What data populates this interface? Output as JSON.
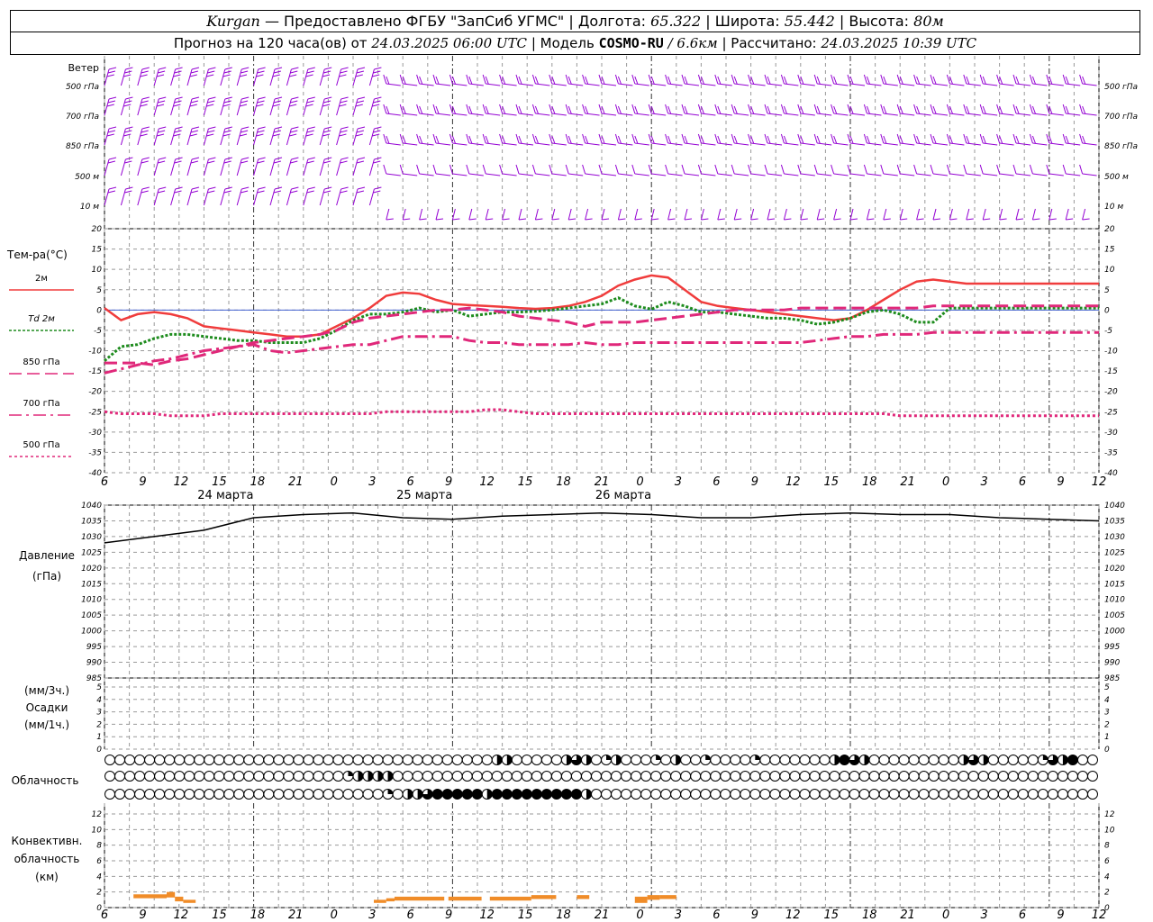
{
  "header": {
    "station": "Kurgan",
    "provider": "— Предоставлено ФГБУ \"ЗапСиб УГМС\" |",
    "lon_label": "Долгота:",
    "lon": "65.322",
    "lat_label": "| Широта:",
    "lat": "55.442",
    "alt_label": "| Высота:",
    "alt": "80м",
    "forecast_label": "Прогноз на 120 часа(ов) от",
    "forecast_start": "24.03.2025 06:00 UTC",
    "model_label": "| Модель",
    "model": "COSMO-RU",
    "model_res": "/ 6.6км",
    "calc_label": "| Рассчитано:",
    "calc_time": "24.03.2025 10:39 UTC"
  },
  "chart_data": [
    {
      "type": "line",
      "panel": "wind",
      "title": "Ветер",
      "levels": [
        "500 гПа",
        "700 гПа",
        "850 гПа",
        "500 м",
        "10 м"
      ],
      "colors": {
        "barbs": "#9400d3"
      }
    },
    {
      "type": "line",
      "panel": "temperature",
      "title": "Тем-ра(°С)",
      "ylim": [
        -40,
        20
      ],
      "yticks": [
        20,
        15,
        10,
        5,
        0,
        -5,
        -10,
        -15,
        -20,
        -25,
        -30,
        -35,
        -40
      ],
      "x_hours_from_start": [
        0,
        2,
        4,
        6,
        8,
        10,
        12,
        14,
        16,
        18,
        20,
        22,
        24,
        26,
        28,
        30,
        32,
        34,
        36,
        38,
        40,
        42,
        44,
        46,
        48,
        50,
        52,
        54,
        56,
        58,
        60,
        62,
        64,
        66,
        68,
        70,
        72,
        74,
        76,
        78,
        80,
        82,
        84,
        86,
        88,
        90,
        92,
        94,
        96,
        98,
        100,
        102,
        104,
        106,
        108,
        110,
        112,
        114,
        116,
        118,
        120
      ],
      "series": [
        {
          "name": "2м",
          "color": "#f03c3c",
          "style": "solid",
          "values": [
            0.5,
            -2.5,
            -1,
            -0.5,
            -1,
            -2,
            -4,
            -4.5,
            -5,
            -5.5,
            -6,
            -6.5,
            -6.5,
            -6,
            -4,
            -2,
            0.5,
            3.5,
            4.3,
            4,
            2.5,
            1.5,
            1.2,
            1,
            0.8,
            0.5,
            0.3,
            0.5,
            1,
            2,
            3.5,
            6,
            7.5,
            8.5,
            8,
            5,
            2,
            1,
            0.5,
            0,
            -0.5,
            -1,
            -1.5,
            -2,
            -2.5,
            -2,
            0,
            2.5,
            5,
            7,
            7.5,
            7,
            6.5,
            6.5,
            6.5,
            6.5,
            6.5,
            6.5,
            6.5,
            6.5,
            6.5
          ]
        },
        {
          "name": "Td 2м",
          "color": "#1e8c1e",
          "style": "dotted",
          "values": [
            -12.5,
            -9,
            -8.5,
            -7,
            -6,
            -6,
            -6.5,
            -7,
            -7.5,
            -7.5,
            -8,
            -8,
            -8,
            -7,
            -5,
            -2.5,
            -1,
            -1,
            -0.5,
            0.5,
            -0.5,
            0,
            -1.5,
            -1,
            -0.5,
            -0.5,
            -0.3,
            0,
            0.5,
            1,
            1.5,
            3,
            1,
            0.2,
            2,
            1,
            -0.5,
            -0.5,
            -1,
            -1.5,
            -2,
            -2,
            -2.5,
            -3.5,
            -3,
            -2,
            -0.5,
            0,
            -1,
            -3,
            -3,
            0.5,
            0.5,
            0.5,
            0.5,
            0.5,
            0.5,
            0.5,
            0.5,
            0.5,
            0.5
          ]
        },
        {
          "name": "850 гПа",
          "color": "#e0287a",
          "style": "dashed",
          "values": [
            -13,
            -13,
            -13,
            -13.5,
            -12.5,
            -12,
            -11,
            -10,
            -9,
            -8,
            -7.5,
            -7,
            -6.5,
            -6,
            -5,
            -3,
            -2,
            -1.5,
            -1,
            -0.5,
            0,
            0,
            0.5,
            0,
            -0.5,
            -1.5,
            -2,
            -2.5,
            -3,
            -4,
            -3,
            -3,
            -3,
            -2.5,
            -2,
            -1.5,
            -1,
            -0.5,
            0,
            0,
            0,
            0,
            0.5,
            0.5,
            0.5,
            0.5,
            0.5,
            0.5,
            0.5,
            0.5,
            1,
            1,
            1,
            1,
            1,
            1,
            1,
            1,
            1,
            1,
            1
          ]
        },
        {
          "name": "700 гПа",
          "color": "#e0287a",
          "style": "dashdot",
          "values": [
            -15.5,
            -14.5,
            -13.5,
            -12.5,
            -12,
            -11,
            -10,
            -9.5,
            -9,
            -8.5,
            -10,
            -10.5,
            -10,
            -9.5,
            -9,
            -8.5,
            -8.5,
            -7.5,
            -6.5,
            -6.5,
            -6.5,
            -6.5,
            -7.5,
            -8,
            -8,
            -8.5,
            -8.5,
            -8.5,
            -8.5,
            -8,
            -8.5,
            -8.5,
            -8,
            -8,
            -8,
            -8,
            -8,
            -8,
            -8,
            -8,
            -8,
            -8,
            -8,
            -7.5,
            -7,
            -6.5,
            -6.5,
            -6,
            -6,
            -6,
            -5.5,
            -5.5,
            -5.5,
            -5.5,
            -5.5,
            -5.5,
            -5.5,
            -5.5,
            -5.5,
            -5.5,
            -5.5
          ]
        },
        {
          "name": "500 гПа",
          "color": "#e0287a",
          "style": "finedash",
          "values": [
            -25,
            -25.5,
            -25.5,
            -25.5,
            -26,
            -26,
            -26,
            -25.5,
            -25.5,
            -25.5,
            -25.5,
            -25.5,
            -25.5,
            -25.5,
            -25.5,
            -25.5,
            -25.5,
            -25,
            -25,
            -25,
            -25,
            -25,
            -25,
            -24.5,
            -24.5,
            -25,
            -25.5,
            -25.5,
            -25.5,
            -25.5,
            -25.5,
            -25.5,
            -25.5,
            -25.5,
            -25.5,
            -25.5,
            -25.5,
            -25.5,
            -25.5,
            -25.5,
            -25.5,
            -25.5,
            -25.5,
            -25.5,
            -25.5,
            -25.5,
            -25.5,
            -25.5,
            -26,
            -26,
            -26,
            -26,
            -26,
            -26,
            -26,
            -26,
            -26,
            -26,
            -26,
            -26,
            -26
          ]
        }
      ]
    },
    {
      "type": "line",
      "panel": "pressure",
      "title": "Давление",
      "ylabel": "(гПа)",
      "ylim": [
        985,
        1040
      ],
      "yticks": [
        1040,
        1035,
        1030,
        1025,
        1020,
        1015,
        1010,
        1005,
        1000,
        995,
        990,
        985
      ],
      "x_hours_from_start": [
        0,
        6,
        12,
        18,
        24,
        30,
        36,
        42,
        48,
        54,
        60,
        66,
        72,
        78,
        84,
        90,
        96,
        102,
        108,
        114,
        120
      ],
      "series": [
        {
          "name": "Давление",
          "color": "#000000",
          "values": [
            1028,
            1030,
            1032,
            1036,
            1037,
            1037.5,
            1036,
            1035.5,
            1036.5,
            1037,
            1037.5,
            1037,
            1036,
            1036,
            1037,
            1037.5,
            1037,
            1037,
            1036,
            1035.5,
            1035
          ]
        }
      ]
    },
    {
      "type": "bar",
      "panel": "precipitation",
      "title": "Осадки",
      "ylabel_top": "(мм/3ч.)",
      "ylabel_bottom": "(мм/1ч.)",
      "ylim": [
        0,
        6
      ],
      "yticks": [
        6,
        5,
        4,
        3,
        2,
        1,
        0
      ],
      "values": []
    },
    {
      "type": "table",
      "panel": "cloudiness",
      "title": "Облачность",
      "slots": 60,
      "rows": [
        {
          "name": "upper",
          "values": [
            0,
            0,
            0,
            0,
            0,
            0,
            0,
            0,
            0,
            0,
            0,
            0,
            0,
            0,
            0,
            0,
            0,
            0,
            0,
            0,
            0,
            0,
            0,
            0,
            0,
            0,
            0,
            0,
            0,
            0,
            0,
            0,
            0,
            0,
            0,
            0,
            0,
            0,
            0,
            0,
            0,
            0,
            0,
            0,
            0,
            0,
            0,
            0,
            0,
            0,
            0,
            0,
            0,
            0,
            0,
            0,
            0,
            0,
            0,
            0
          ]
        },
        {
          "name": "middle",
          "values": [
            0,
            0,
            0,
            0,
            0,
            0,
            0,
            0,
            0,
            0,
            0,
            0,
            0,
            0,
            0,
            0,
            0,
            0,
            0,
            0,
            0,
            0,
            0,
            0,
            0,
            0,
            0,
            0,
            0,
            0,
            0,
            0,
            0,
            0,
            0,
            0,
            0,
            0,
            0,
            0,
            0,
            0,
            0,
            0,
            0,
            0,
            0,
            0,
            0,
            0,
            0,
            0,
            0,
            0,
            0,
            0,
            0,
            0,
            0,
            0
          ]
        },
        {
          "name": "lower",
          "values": [
            0,
            0,
            0,
            0,
            0,
            0,
            0,
            0,
            0,
            0,
            0,
            0,
            0,
            0,
            0,
            0,
            0,
            0,
            0,
            0,
            0,
            0,
            0,
            0,
            0,
            0,
            0,
            0,
            0,
            0,
            0,
            0,
            0,
            0,
            0,
            0,
            0,
            0,
            0,
            0,
            0,
            0,
            0,
            0,
            0,
            0,
            0,
            0,
            0,
            0,
            0,
            0,
            0,
            0,
            0,
            0,
            0,
            0,
            0,
            0
          ]
        }
      ],
      "cells": [
        {
          "r": 0,
          "i": 46,
          "f": 0.5
        },
        {
          "r": 0,
          "i": 47,
          "f": 0.75
        },
        {
          "r": 0,
          "i": 48,
          "f": 0.5
        },
        {
          "r": 0,
          "i": 50,
          "f": 0.25
        },
        {
          "r": 0,
          "i": 51,
          "f": 0.5
        },
        {
          "r": 0,
          "i": 55,
          "f": 0.25
        },
        {
          "r": 0,
          "i": 57,
          "f": 0.5
        },
        {
          "r": 0,
          "i": 60,
          "f": 0.25
        },
        {
          "r": 0,
          "i": 65,
          "f": 0.25
        },
        {
          "r": 0,
          "i": 73,
          "f": 0.5
        },
        {
          "r": 0,
          "i": 74,
          "f": 1
        },
        {
          "r": 0,
          "i": 75,
          "f": 0.75
        },
        {
          "r": 0,
          "i": 76,
          "f": 0.5
        },
        {
          "r": 0,
          "i": 86,
          "f": 0.5
        },
        {
          "r": 0,
          "i": 87,
          "f": 0.75
        },
        {
          "r": 0,
          "i": 88,
          "f": 0.5
        },
        {
          "r": 0,
          "i": 94,
          "f": 0.25
        },
        {
          "r": 0,
          "i": 95,
          "f": 0.75
        },
        {
          "r": 0,
          "i": 96,
          "f": 0.5
        },
        {
          "r": 0,
          "i": 97,
          "f": 1
        },
        {
          "r": 0,
          "i": 39,
          "f": 0.5
        },
        {
          "r": 0,
          "i": 40,
          "f": 0.5
        },
        {
          "r": 1,
          "i": 24,
          "f": 0.25
        },
        {
          "r": 1,
          "i": 25,
          "f": 0.5
        },
        {
          "r": 1,
          "i": 26,
          "f": 0.5
        },
        {
          "r": 1,
          "i": 27,
          "f": 0.5
        },
        {
          "r": 1,
          "i": 28,
          "f": 0.5
        },
        {
          "r": 2,
          "i": 28,
          "f": 0.25
        },
        {
          "r": 2,
          "i": 30,
          "f": 0.5
        },
        {
          "r": 2,
          "i": 31,
          "f": 0.5
        },
        {
          "r": 2,
          "i": 32,
          "f": 0.75
        },
        {
          "r": 2,
          "i": 33,
          "f": 1
        },
        {
          "r": 2,
          "i": 34,
          "f": 1
        },
        {
          "r": 2,
          "i": 35,
          "f": 1
        },
        {
          "r": 2,
          "i": 36,
          "f": 1
        },
        {
          "r": 2,
          "i": 37,
          "f": 1
        },
        {
          "r": 2,
          "i": 38,
          "f": 0.5
        },
        {
          "r": 2,
          "i": 39,
          "f": 1
        },
        {
          "r": 2,
          "i": 40,
          "f": 1
        },
        {
          "r": 2,
          "i": 41,
          "f": 1
        },
        {
          "r": 2,
          "i": 42,
          "f": 1
        },
        {
          "r": 2,
          "i": 43,
          "f": 1
        },
        {
          "r": 2,
          "i": 44,
          "f": 1
        },
        {
          "r": 2,
          "i": 45,
          "f": 1
        },
        {
          "r": 2,
          "i": 46,
          "f": 1
        },
        {
          "r": 2,
          "i": 47,
          "f": 1
        },
        {
          "r": 2,
          "i": 48,
          "f": 0.5
        }
      ]
    },
    {
      "type": "bar",
      "panel": "convective",
      "title": "Конвективн. облачность (км)",
      "ylim": [
        0,
        13
      ],
      "yticks": [
        12,
        10,
        8,
        6,
        4,
        2,
        0
      ],
      "segments": [
        {
          "from_h": 3.5,
          "to_h": 7.5,
          "bottom": 1.2,
          "top": 1.7
        },
        {
          "from_h": 7.5,
          "to_h": 8.5,
          "bottom": 1.3,
          "top": 2.0
        },
        {
          "from_h": 8.5,
          "to_h": 9.5,
          "bottom": 0.8,
          "top": 1.4
        },
        {
          "from_h": 9.5,
          "to_h": 11,
          "bottom": 0.6,
          "top": 1.0
        },
        {
          "from_h": 32.5,
          "to_h": 34,
          "bottom": 0.6,
          "top": 1.0
        },
        {
          "from_h": 34,
          "to_h": 35,
          "bottom": 0.8,
          "top": 1.2
        },
        {
          "from_h": 35,
          "to_h": 41,
          "bottom": 0.9,
          "top": 1.4
        },
        {
          "from_h": 41.5,
          "to_h": 45.5,
          "bottom": 0.9,
          "top": 1.4
        },
        {
          "from_h": 46.5,
          "to_h": 51.5,
          "bottom": 0.9,
          "top": 1.4
        },
        {
          "from_h": 51.5,
          "to_h": 54.5,
          "bottom": 1.1,
          "top": 1.6
        },
        {
          "from_h": 57,
          "to_h": 58.5,
          "bottom": 1.1,
          "top": 1.6
        },
        {
          "from_h": 64,
          "to_h": 65.5,
          "bottom": 0.6,
          "top": 1.4
        },
        {
          "from_h": 65.5,
          "to_h": 67,
          "bottom": 1.0,
          "top": 1.6
        },
        {
          "from_h": 67,
          "to_h": 69,
          "bottom": 1.1,
          "top": 1.6
        }
      ],
      "color": "#f08c28"
    }
  ],
  "axis": {
    "hour_labels": [
      "6",
      "9",
      "12",
      "15",
      "18",
      "21",
      "0",
      "3",
      "6",
      "9",
      "12",
      "15",
      "18",
      "21",
      "0",
      "3",
      "6",
      "9",
      "12",
      "15",
      "18",
      "21",
      "0",
      "3",
      "6",
      "9",
      "12"
    ],
    "day_labels": [
      "24 марта",
      "25 марта",
      "26 марта"
    ]
  }
}
